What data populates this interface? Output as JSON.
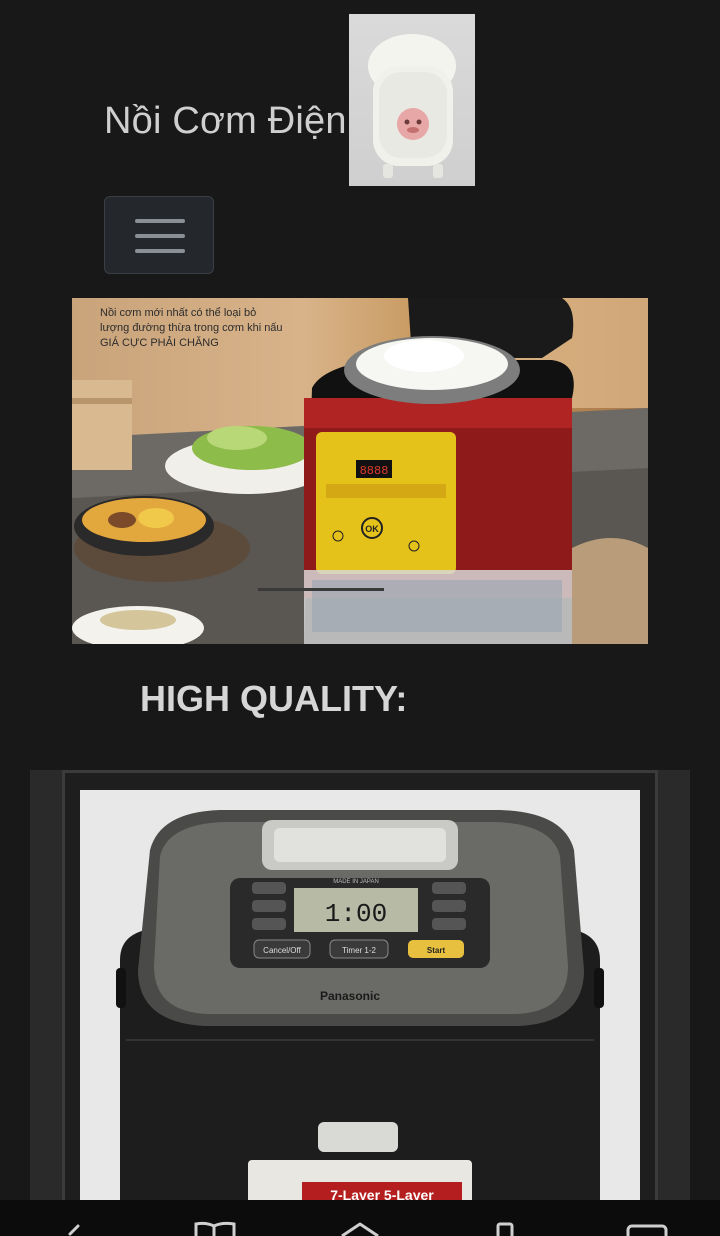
{
  "header": {
    "brand": "Nồi Cơm Điện"
  },
  "hero": {
    "caption_line1": "Nồi cơm mới nhất có thể loại bỏ",
    "caption_line2": "lượng đường thừa trong cơm khi nấu",
    "caption_line3": "GIÁ CỰC PHẢI CHĂNG",
    "display_digits": "8888",
    "ok_label": "OK"
  },
  "section": {
    "title": "HIGH QUALITY:"
  },
  "product": {
    "brand": "Panasonic",
    "display": "1:00",
    "btn_cancel": "Cancel/Off",
    "btn_timer": "Timer 1-2",
    "btn_start": "Start",
    "label_made": "MADE IN JAPAN",
    "layers": "7-Layer 5-Layer"
  },
  "nav": {
    "icons": [
      "back-icon",
      "book-icon",
      "home-icon",
      "tabs-icon",
      "windows-icon"
    ]
  },
  "colors": {
    "background": "#181818",
    "cooker_red": "#8e1a1a",
    "panel_yellow": "#e5c21a",
    "start_button": "#e8c040"
  }
}
